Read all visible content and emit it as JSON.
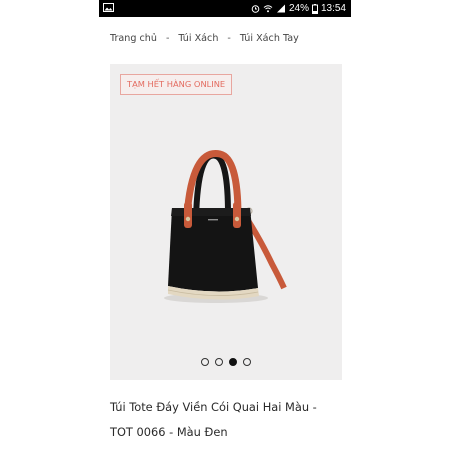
{
  "status_bar": {
    "battery_percent": "24%",
    "time": "13:54",
    "icons": [
      "gallery-icon",
      "alarm-icon",
      "wifi-icon",
      "signal-icon",
      "battery-icon"
    ]
  },
  "breadcrumb": {
    "items": [
      "Trang chủ",
      "Túi Xách",
      "Túi Xách Tay"
    ],
    "separator": "-"
  },
  "gallery": {
    "badge": "TẠM HẾT HÀNG ONLINE",
    "slide_count": 4,
    "active_slide": 3
  },
  "product": {
    "title": "Túi Tote Đáy Viền Cói Quai Hai Màu - TOT 0066 - Màu Đen"
  },
  "colors": {
    "badge_text": "#e36b5f",
    "bag_body": "#141414",
    "handle": "#c85a3a",
    "gallery_bg": "#efeeee"
  }
}
